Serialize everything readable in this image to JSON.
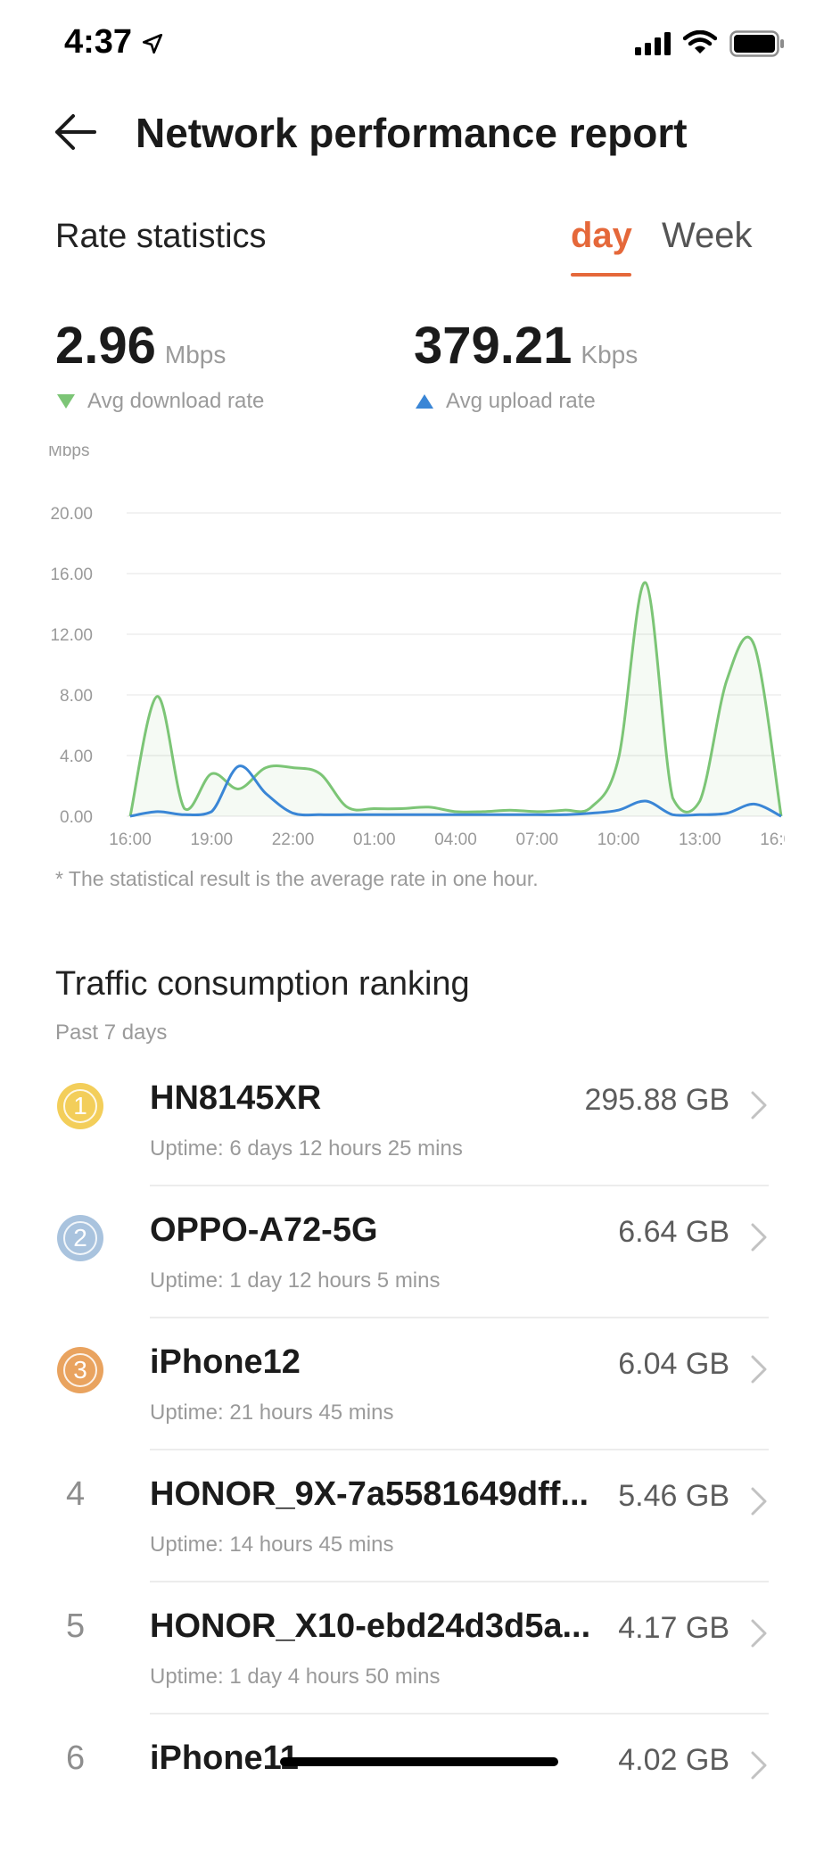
{
  "status_bar": {
    "time": "4:37"
  },
  "header": {
    "title": "Network performance report"
  },
  "rate_stats": {
    "label": "Rate statistics",
    "tabs": {
      "day": "day",
      "week": "Week"
    },
    "download": {
      "value": "2.96",
      "unit": "Mbps",
      "caption": "Avg download rate"
    },
    "upload": {
      "value": "379.21",
      "unit": "Kbps",
      "caption": "Avg upload rate"
    },
    "footnote": "* The statistical result is the average rate in one hour."
  },
  "chart_data": {
    "type": "area",
    "ylabel": "Mbps",
    "ylim": [
      0,
      20
    ],
    "yticks": [
      "0.00",
      "4.00",
      "8.00",
      "12.00",
      "16.00",
      "20.00"
    ],
    "xticks": [
      "16:00",
      "19:00",
      "22:00",
      "01:00",
      "04:00",
      "07:00",
      "10:00",
      "13:00",
      "16:00"
    ],
    "x_hours": [
      0,
      1,
      2,
      3,
      4,
      5,
      6,
      7,
      8,
      9,
      10,
      11,
      12,
      13,
      14,
      15,
      16,
      17,
      18,
      19,
      20,
      21,
      22,
      23,
      24
    ],
    "series": [
      {
        "color": "#7cc576",
        "values": [
          0.0,
          7.9,
          0.5,
          2.8,
          1.8,
          3.2,
          3.2,
          2.8,
          0.6,
          0.5,
          0.5,
          0.6,
          0.3,
          0.3,
          0.4,
          0.3,
          0.4,
          0.6,
          3.8,
          15.4,
          1.2,
          1.0,
          9.0,
          11.3,
          0.0
        ]
      },
      {
        "color": "#3a86d6",
        "values": [
          0.0,
          0.3,
          0.1,
          0.3,
          3.3,
          1.5,
          0.2,
          0.1,
          0.1,
          0.1,
          0.1,
          0.1,
          0.1,
          0.1,
          0.1,
          0.1,
          0.1,
          0.2,
          0.4,
          1.0,
          0.1,
          0.1,
          0.2,
          0.8,
          0.0
        ]
      }
    ]
  },
  "ranking": {
    "title": "Traffic consumption ranking",
    "subtitle": "Past 7 days",
    "items": [
      {
        "rank": "1",
        "name": "HN8145XR",
        "size": "295.88 GB",
        "uptime": "Uptime: 6 days 12 hours 25 mins",
        "medal_color": "#f3ce5a"
      },
      {
        "rank": "2",
        "name": "OPPO-A72-5G",
        "size": "6.64 GB",
        "uptime": "Uptime: 1 day 12 hours 5 mins",
        "medal_color": "#a9c3de"
      },
      {
        "rank": "3",
        "name": "iPhone12",
        "size": "6.04 GB",
        "uptime": "Uptime: 21 hours 45 mins",
        "medal_color": "#e9a35f"
      },
      {
        "rank": "4",
        "name": "HONOR_9X-7a5581649dff...",
        "size": "5.46 GB",
        "uptime": "Uptime: 14 hours 45 mins"
      },
      {
        "rank": "5",
        "name": "HONOR_X10-ebd24d3d5a...",
        "size": "4.17 GB",
        "uptime": "Uptime: 1 day 4 hours 50 mins"
      },
      {
        "rank": "6",
        "name": "iPhone11",
        "size": "4.02 GB",
        "uptime": ""
      }
    ]
  }
}
